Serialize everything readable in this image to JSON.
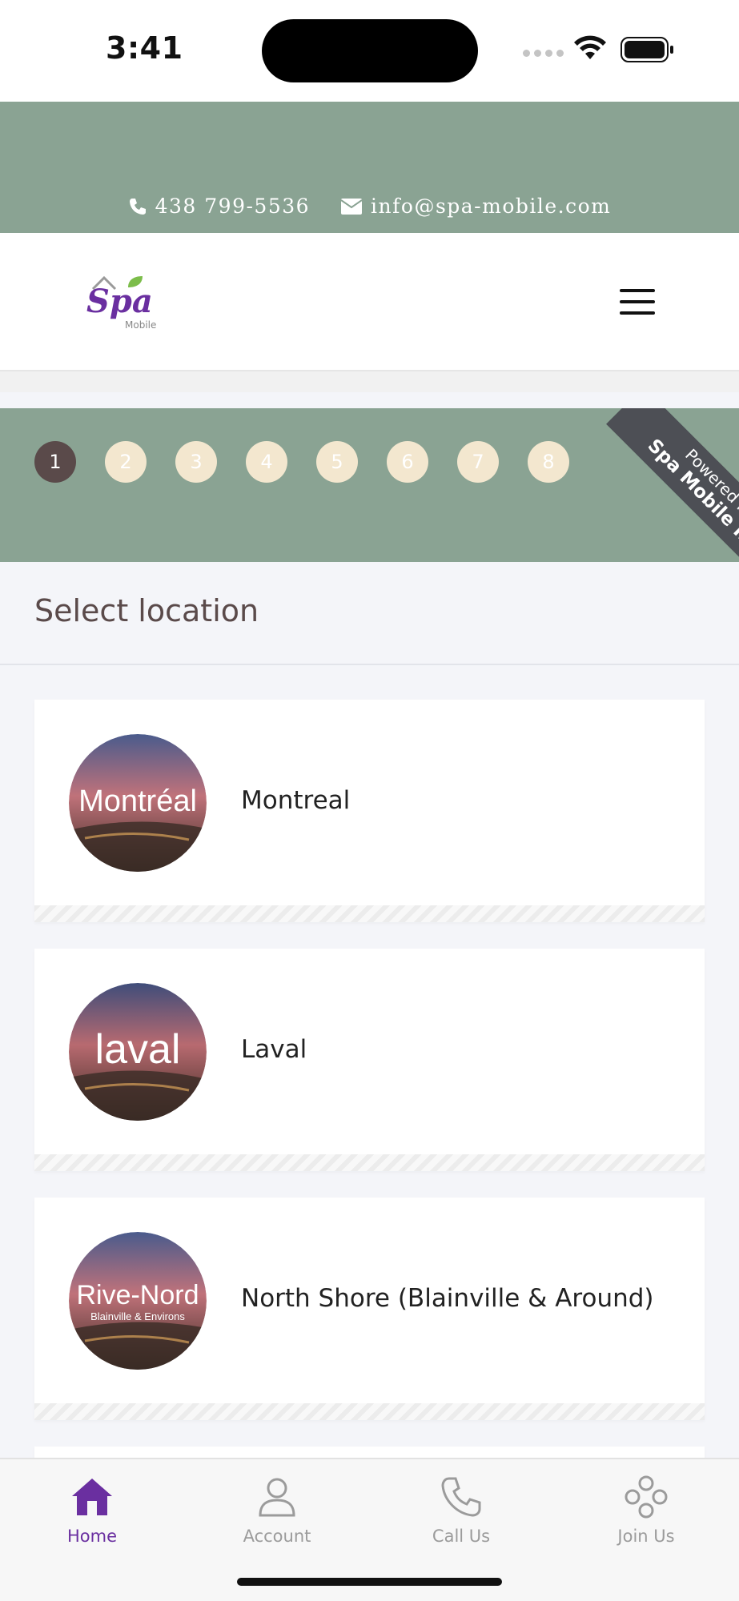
{
  "status_bar": {
    "time": "3:41"
  },
  "contact": {
    "phone": "438 799-5536",
    "email": "info@spa-mobile.com"
  },
  "logo": {
    "text": "Spa",
    "subtext": "Mobile"
  },
  "stepper": {
    "steps": [
      "1",
      "2",
      "3",
      "4",
      "5",
      "6",
      "7",
      "8"
    ],
    "active_step": "1"
  },
  "ribbon": {
    "line1": "Powered by",
    "line2": "Spa Mobile Inc."
  },
  "section": {
    "title": "Select location"
  },
  "locations": [
    {
      "label": "Montreal",
      "badge": "Montréal",
      "badge_sub": ""
    },
    {
      "label": "Laval",
      "badge": "laval",
      "badge_sub": ""
    },
    {
      "label": "North Shore (Blainville & Around)",
      "badge": "Rive-Nord",
      "badge_sub": "Blainville & Environs"
    }
  ],
  "bottom_nav": [
    {
      "label": "Home",
      "icon": "home-icon",
      "active": true
    },
    {
      "label": "Account",
      "icon": "account-icon",
      "active": false
    },
    {
      "label": "Call Us",
      "icon": "phone-icon",
      "active": false
    },
    {
      "label": "Join Us",
      "icon": "join-icon",
      "active": false
    }
  ],
  "colors": {
    "band": "#8aa393",
    "accent": "#6a2fa0",
    "step_active": "#5a4a4a",
    "step_inactive": "#f3e7cf",
    "ribbon": "#4d4f55"
  }
}
